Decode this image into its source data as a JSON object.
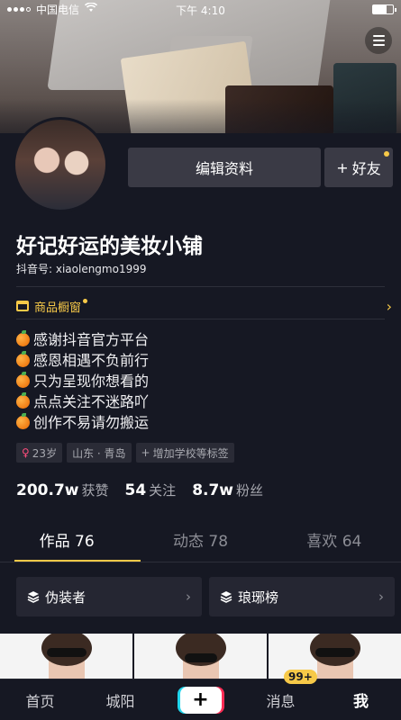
{
  "status": {
    "carrier": "中国电信",
    "time": "下午 4:10"
  },
  "profile": {
    "name": "好记好运的美妆小铺",
    "id_label": "抖音号: xiaolengmo1999",
    "edit_label": "编辑资料",
    "friend_label": "好友"
  },
  "shop": {
    "label": "商品橱窗"
  },
  "bio": [
    "感谢抖音官方平台",
    "感恩相遇不负前行",
    "只为呈现你想看的",
    "点点关注不迷路吖",
    "创作不易请勿搬运"
  ],
  "tags": {
    "age": "23岁",
    "location": "山东 · 青岛",
    "add": "增加学校等标签"
  },
  "stats": {
    "likes_value": "200.7w",
    "likes_label": "获赞",
    "following_value": "54",
    "following_label": "关注",
    "followers_value": "8.7w",
    "followers_label": "粉丝"
  },
  "tabs": [
    "作品 76",
    "动态 78",
    "喜欢 64"
  ],
  "playlists": [
    "伪装者",
    "琅琊榜"
  ],
  "nav": {
    "home": "首页",
    "city": "城阳",
    "plus": "+",
    "messages": "消息",
    "badge": "99+",
    "me": "我"
  },
  "colors": {
    "accent": "#f7c948",
    "background": "#161823",
    "card": "#3a3a45"
  }
}
